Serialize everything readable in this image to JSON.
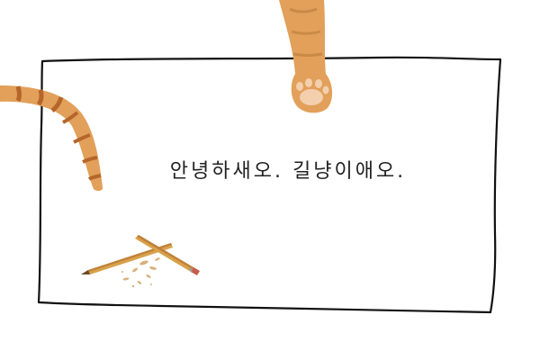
{
  "message": {
    "text": "안녕하새오. 길냥이애오."
  },
  "illustration": {
    "elements": [
      "hand-drawn-frame",
      "cat-paw",
      "cat-tail",
      "broken-pencil",
      "pencil-shavings"
    ],
    "colors": {
      "frame": "#111111",
      "fur": "#e2a05a",
      "fur_stripe": "#b5662a",
      "paw_pad": "#f3cfae",
      "pencil_wood": "#d8a24a",
      "pencil_paint": "#c0813a",
      "eraser": "#c75c4a"
    }
  }
}
